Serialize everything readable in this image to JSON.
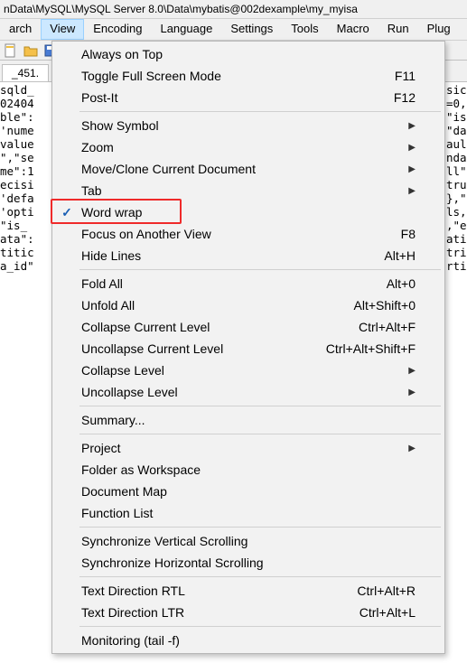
{
  "title_bar": "nData\\MySQL\\MySQL Server 8.0\\Data\\mybatis@002dexample\\my_myisa",
  "menubar": {
    "items": [
      "arch",
      "View",
      "Encoding",
      "Language",
      "Settings",
      "Tools",
      "Macro",
      "Run",
      "Plug"
    ],
    "active_index": 1
  },
  "tab_label": "_451.",
  "dropdown": {
    "groups": [
      [
        {
          "label": "Always on Top"
        },
        {
          "label": "Toggle Full Screen Mode",
          "shortcut": "F11"
        },
        {
          "label": "Post-It",
          "shortcut": "F12"
        }
      ],
      [
        {
          "label": "Show Symbol",
          "submenu": true
        },
        {
          "label": "Zoom",
          "submenu": true
        },
        {
          "label": "Move/Clone Current Document",
          "submenu": true
        },
        {
          "label": "Tab",
          "submenu": true
        },
        {
          "label": "Word wrap",
          "checked": true,
          "highlight": true
        },
        {
          "label": "Focus on Another View",
          "shortcut": "F8"
        },
        {
          "label": "Hide Lines",
          "shortcut": "Alt+H"
        }
      ],
      [
        {
          "label": "Fold All",
          "shortcut": "Alt+0"
        },
        {
          "label": "Unfold All",
          "shortcut": "Alt+Shift+0"
        },
        {
          "label": "Collapse Current Level",
          "shortcut": "Ctrl+Alt+F"
        },
        {
          "label": "Uncollapse Current Level",
          "shortcut": "Ctrl+Alt+Shift+F"
        },
        {
          "label": "Collapse Level",
          "submenu": true
        },
        {
          "label": "Uncollapse Level",
          "submenu": true
        }
      ],
      [
        {
          "label": "Summary..."
        }
      ],
      [
        {
          "label": "Project",
          "submenu": true
        },
        {
          "label": "Folder as Workspace"
        },
        {
          "label": "Document Map"
        },
        {
          "label": "Function List"
        }
      ],
      [
        {
          "label": "Synchronize Vertical Scrolling"
        },
        {
          "label": "Synchronize Horizontal Scrolling"
        }
      ],
      [
        {
          "label": "Text Direction RTL",
          "shortcut": "Ctrl+Alt+R"
        },
        {
          "label": "Text Direction LTR",
          "shortcut": "Ctrl+Alt+L"
        }
      ],
      [
        {
          "label": "Monitoring (tail -f)"
        }
      ]
    ]
  },
  "left_text": "sqld_\n02404\nble\":\n'nume\nvalue\n\",\"se\nme\":1\necisi\n'defa\n'opti\n\"is_\nata\":\ntitic\na_id\"",
  "right_text": "sic\n=0,\n\"is\n\"da\naul\nnda\nll\"\ntru\n},\"\nls,\n,\"e\nati\ntri\nrti"
}
